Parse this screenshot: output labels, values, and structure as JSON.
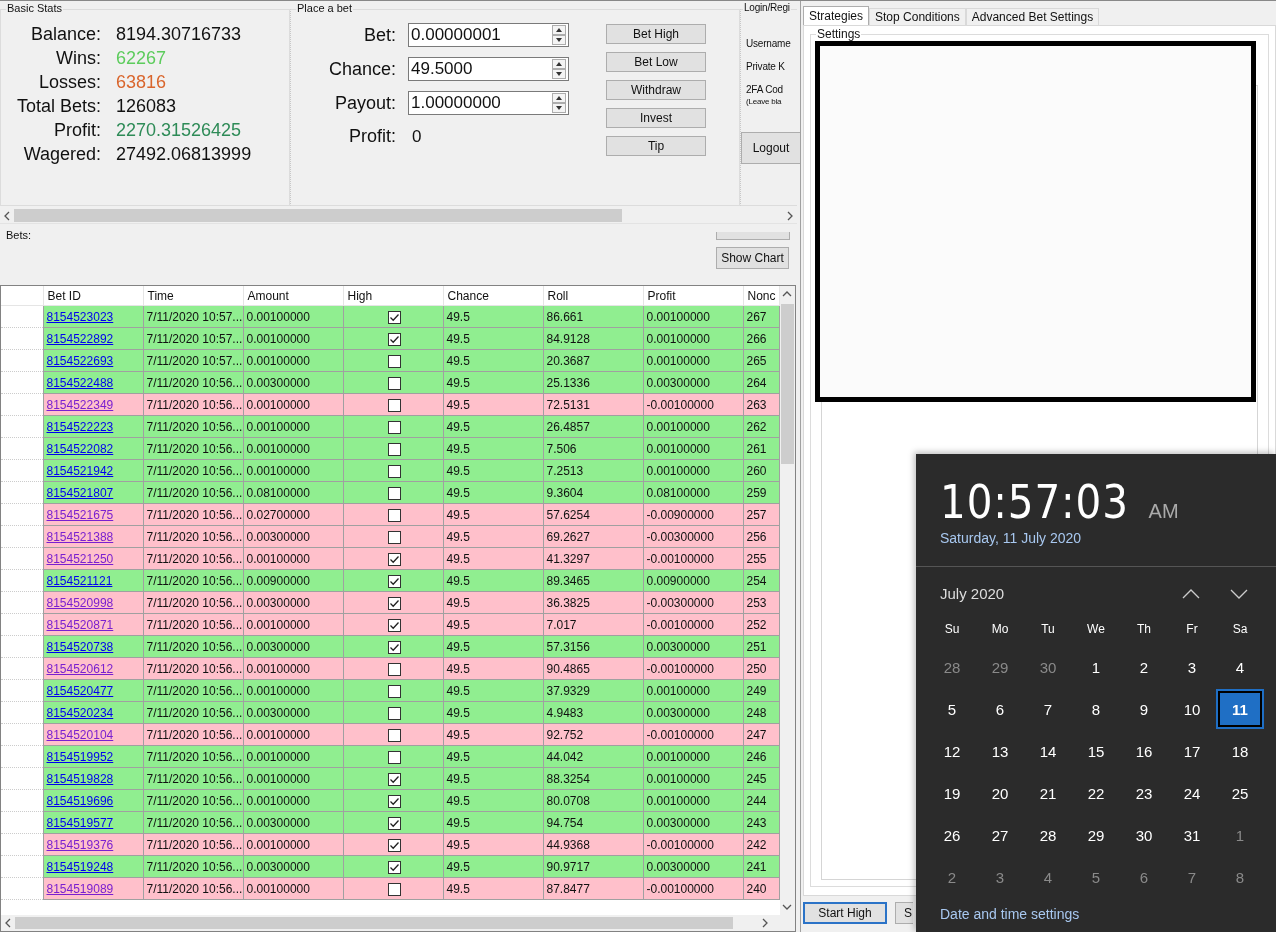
{
  "stats": {
    "title": "Basic Stats",
    "items": [
      {
        "label": "Balance:",
        "value": "8194.30716733",
        "kind": "plain"
      },
      {
        "label": "Wins:",
        "value": "62267",
        "kind": "win"
      },
      {
        "label": "Losses:",
        "value": "63816",
        "kind": "loss"
      },
      {
        "label": "Total Bets:",
        "value": "126083",
        "kind": "plain"
      },
      {
        "label": "Profit:",
        "value": "2270.31526425",
        "kind": "profit"
      },
      {
        "label": "Wagered:",
        "value": "27492.06813999",
        "kind": "plain"
      }
    ]
  },
  "place_bet": {
    "title": "Place a bet",
    "fields": [
      {
        "label": "Bet:",
        "value": "0.00000001"
      },
      {
        "label": "Chance:",
        "value": "49.5000"
      },
      {
        "label": "Payout:",
        "value": "1.00000000"
      }
    ],
    "profit_label": "Profit:",
    "profit_value": "0"
  },
  "actions": [
    "Bet High",
    "Bet Low",
    "Withdraw",
    "Invest",
    "Tip"
  ],
  "login": {
    "title": "Login/Regi",
    "labels": [
      "Username",
      "Private K",
      "2FA Cod"
    ],
    "note": "(Leave bla",
    "button": "Logout"
  },
  "bets_label": "Bets:",
  "chart_button": "Show Chart",
  "table": {
    "columns": [
      "Bet ID",
      "Time",
      "Amount",
      "High",
      "Chance",
      "Roll",
      "Profit",
      "Nonc"
    ],
    "rows": [
      {
        "id": "8154523023",
        "time": "7/11/2020 10:57...",
        "amount": "0.00100000",
        "high": true,
        "chance": "49.5",
        "roll": "86.661",
        "profit": "0.00100000",
        "nonce": "267",
        "win": true
      },
      {
        "id": "8154522892",
        "time": "7/11/2020 10:57...",
        "amount": "0.00100000",
        "high": true,
        "chance": "49.5",
        "roll": "84.9128",
        "profit": "0.00100000",
        "nonce": "266",
        "win": true
      },
      {
        "id": "8154522693",
        "time": "7/11/2020 10:57...",
        "amount": "0.00100000",
        "high": false,
        "chance": "49.5",
        "roll": "20.3687",
        "profit": "0.00100000",
        "nonce": "265",
        "win": true
      },
      {
        "id": "8154522488",
        "time": "7/11/2020 10:56...",
        "amount": "0.00300000",
        "high": false,
        "chance": "49.5",
        "roll": "25.1336",
        "profit": "0.00300000",
        "nonce": "264",
        "win": true
      },
      {
        "id": "8154522349",
        "time": "7/11/2020 10:56...",
        "amount": "0.00100000",
        "high": false,
        "chance": "49.5",
        "roll": "72.5131",
        "profit": "-0.00100000",
        "nonce": "263",
        "win": false
      },
      {
        "id": "8154522223",
        "time": "7/11/2020 10:56...",
        "amount": "0.00100000",
        "high": false,
        "chance": "49.5",
        "roll": "26.4857",
        "profit": "0.00100000",
        "nonce": "262",
        "win": true
      },
      {
        "id": "8154522082",
        "time": "7/11/2020 10:56...",
        "amount": "0.00100000",
        "high": false,
        "chance": "49.5",
        "roll": "7.506",
        "profit": "0.00100000",
        "nonce": "261",
        "win": true
      },
      {
        "id": "8154521942",
        "time": "7/11/2020 10:56...",
        "amount": "0.00100000",
        "high": false,
        "chance": "49.5",
        "roll": "7.2513",
        "profit": "0.00100000",
        "nonce": "260",
        "win": true
      },
      {
        "id": "8154521807",
        "time": "7/11/2020 10:56...",
        "amount": "0.08100000",
        "high": false,
        "chance": "49.5",
        "roll": "9.3604",
        "profit": "0.08100000",
        "nonce": "259",
        "win": true
      },
      {
        "id": "8154521675",
        "time": "7/11/2020 10:56...",
        "amount": "0.02700000",
        "high": false,
        "chance": "49.5",
        "roll": "57.6254",
        "profit": "-0.00900000",
        "nonce": "257",
        "win": false
      },
      {
        "id": "8154521388",
        "time": "7/11/2020 10:56...",
        "amount": "0.00300000",
        "high": false,
        "chance": "49.5",
        "roll": "69.2627",
        "profit": "-0.00300000",
        "nonce": "256",
        "win": false
      },
      {
        "id": "8154521250",
        "time": "7/11/2020 10:56...",
        "amount": "0.00100000",
        "high": true,
        "chance": "49.5",
        "roll": "41.3297",
        "profit": "-0.00100000",
        "nonce": "255",
        "win": false
      },
      {
        "id": "8154521121",
        "time": "7/11/2020 10:56...",
        "amount": "0.00900000",
        "high": true,
        "chance": "49.5",
        "roll": "89.3465",
        "profit": "0.00900000",
        "nonce": "254",
        "win": true
      },
      {
        "id": "8154520998",
        "time": "7/11/2020 10:56...",
        "amount": "0.00300000",
        "high": true,
        "chance": "49.5",
        "roll": "36.3825",
        "profit": "-0.00300000",
        "nonce": "253",
        "win": false
      },
      {
        "id": "8154520871",
        "time": "7/11/2020 10:56...",
        "amount": "0.00100000",
        "high": true,
        "chance": "49.5",
        "roll": "7.017",
        "profit": "-0.00100000",
        "nonce": "252",
        "win": false
      },
      {
        "id": "8154520738",
        "time": "7/11/2020 10:56...",
        "amount": "0.00300000",
        "high": true,
        "chance": "49.5",
        "roll": "57.3156",
        "profit": "0.00300000",
        "nonce": "251",
        "win": true
      },
      {
        "id": "8154520612",
        "time": "7/11/2020 10:56...",
        "amount": "0.00100000",
        "high": false,
        "chance": "49.5",
        "roll": "90.4865",
        "profit": "-0.00100000",
        "nonce": "250",
        "win": false
      },
      {
        "id": "8154520477",
        "time": "7/11/2020 10:56...",
        "amount": "0.00100000",
        "high": false,
        "chance": "49.5",
        "roll": "37.9329",
        "profit": "0.00100000",
        "nonce": "249",
        "win": true
      },
      {
        "id": "8154520234",
        "time": "7/11/2020 10:56...",
        "amount": "0.00300000",
        "high": false,
        "chance": "49.5",
        "roll": "4.9483",
        "profit": "0.00300000",
        "nonce": "248",
        "win": true
      },
      {
        "id": "8154520104",
        "time": "7/11/2020 10:56...",
        "amount": "0.00100000",
        "high": false,
        "chance": "49.5",
        "roll": "92.752",
        "profit": "-0.00100000",
        "nonce": "247",
        "win": false
      },
      {
        "id": "8154519952",
        "time": "7/11/2020 10:56...",
        "amount": "0.00100000",
        "high": false,
        "chance": "49.5",
        "roll": "44.042",
        "profit": "0.00100000",
        "nonce": "246",
        "win": true
      },
      {
        "id": "8154519828",
        "time": "7/11/2020 10:56...",
        "amount": "0.00100000",
        "high": true,
        "chance": "49.5",
        "roll": "88.3254",
        "profit": "0.00100000",
        "nonce": "245",
        "win": true
      },
      {
        "id": "8154519696",
        "time": "7/11/2020 10:56...",
        "amount": "0.00100000",
        "high": true,
        "chance": "49.5",
        "roll": "80.0708",
        "profit": "0.00100000",
        "nonce": "244",
        "win": true
      },
      {
        "id": "8154519577",
        "time": "7/11/2020 10:56...",
        "amount": "0.00300000",
        "high": true,
        "chance": "49.5",
        "roll": "94.754",
        "profit": "0.00300000",
        "nonce": "243",
        "win": true
      },
      {
        "id": "8154519376",
        "time": "7/11/2020 10:56...",
        "amount": "0.00100000",
        "high": true,
        "chance": "49.5",
        "roll": "44.9368",
        "profit": "-0.00100000",
        "nonce": "242",
        "win": false
      },
      {
        "id": "8154519248",
        "time": "7/11/2020 10:56...",
        "amount": "0.00300000",
        "high": true,
        "chance": "49.5",
        "roll": "90.9717",
        "profit": "0.00300000",
        "nonce": "241",
        "win": true
      },
      {
        "id": "8154519089",
        "time": "7/11/2020 10:56...",
        "amount": "0.00100000",
        "high": false,
        "chance": "49.5",
        "roll": "87.8477",
        "profit": "-0.00100000",
        "nonce": "240",
        "win": false
      }
    ]
  },
  "right_panel": {
    "tabs": [
      {
        "label": "Strategies",
        "selected": true
      },
      {
        "label": "Stop Conditions",
        "selected": false
      },
      {
        "label": "Advanced Bet Settings",
        "selected": false
      }
    ],
    "group_title": "Settings",
    "buttons": [
      "Start High",
      "S"
    ]
  },
  "clock": {
    "time": "10:57:03",
    "meridiem": "AM",
    "date": "Saturday, 11 July 2020",
    "month": "July 2020",
    "weekdays": [
      "Su",
      "Mo",
      "Tu",
      "We",
      "Th",
      "Fr",
      "Sa"
    ],
    "weeks": [
      [
        {
          "day": "28",
          "current": false,
          "selected": false
        },
        {
          "day": "29",
          "current": false,
          "selected": false
        },
        {
          "day": "30",
          "current": false,
          "selected": false
        },
        {
          "day": "1",
          "current": true,
          "selected": false
        },
        {
          "day": "2",
          "current": true,
          "selected": false
        },
        {
          "day": "3",
          "current": true,
          "selected": false
        },
        {
          "day": "4",
          "current": true,
          "selected": false
        }
      ],
      [
        {
          "day": "5",
          "current": true,
          "selected": false
        },
        {
          "day": "6",
          "current": true,
          "selected": false
        },
        {
          "day": "7",
          "current": true,
          "selected": false
        },
        {
          "day": "8",
          "current": true,
          "selected": false
        },
        {
          "day": "9",
          "current": true,
          "selected": false
        },
        {
          "day": "10",
          "current": true,
          "selected": false
        },
        {
          "day": "11",
          "current": true,
          "selected": true
        }
      ],
      [
        {
          "day": "12",
          "current": true,
          "selected": false
        },
        {
          "day": "13",
          "current": true,
          "selected": false
        },
        {
          "day": "14",
          "current": true,
          "selected": false
        },
        {
          "day": "15",
          "current": true,
          "selected": false
        },
        {
          "day": "16",
          "current": true,
          "selected": false
        },
        {
          "day": "17",
          "current": true,
          "selected": false
        },
        {
          "day": "18",
          "current": true,
          "selected": false
        }
      ],
      [
        {
          "day": "19",
          "current": true,
          "selected": false
        },
        {
          "day": "20",
          "current": true,
          "selected": false
        },
        {
          "day": "21",
          "current": true,
          "selected": false
        },
        {
          "day": "22",
          "current": true,
          "selected": false
        },
        {
          "day": "23",
          "current": true,
          "selected": false
        },
        {
          "day": "24",
          "current": true,
          "selected": false
        },
        {
          "day": "25",
          "current": true,
          "selected": false
        }
      ],
      [
        {
          "day": "26",
          "current": true,
          "selected": false
        },
        {
          "day": "27",
          "current": true,
          "selected": false
        },
        {
          "day": "28",
          "current": true,
          "selected": false
        },
        {
          "day": "29",
          "current": true,
          "selected": false
        },
        {
          "day": "30",
          "current": true,
          "selected": false
        },
        {
          "day": "31",
          "current": true,
          "selected": false
        },
        {
          "day": "1",
          "current": false,
          "selected": false
        }
      ],
      [
        {
          "day": "2",
          "current": false,
          "selected": false
        },
        {
          "day": "3",
          "current": false,
          "selected": false
        },
        {
          "day": "4",
          "current": false,
          "selected": false
        },
        {
          "day": "5",
          "current": false,
          "selected": false
        },
        {
          "day": "6",
          "current": false,
          "selected": false
        },
        {
          "day": "7",
          "current": false,
          "selected": false
        },
        {
          "day": "8",
          "current": false,
          "selected": false
        }
      ]
    ],
    "settings_link": "Date and time settings"
  }
}
